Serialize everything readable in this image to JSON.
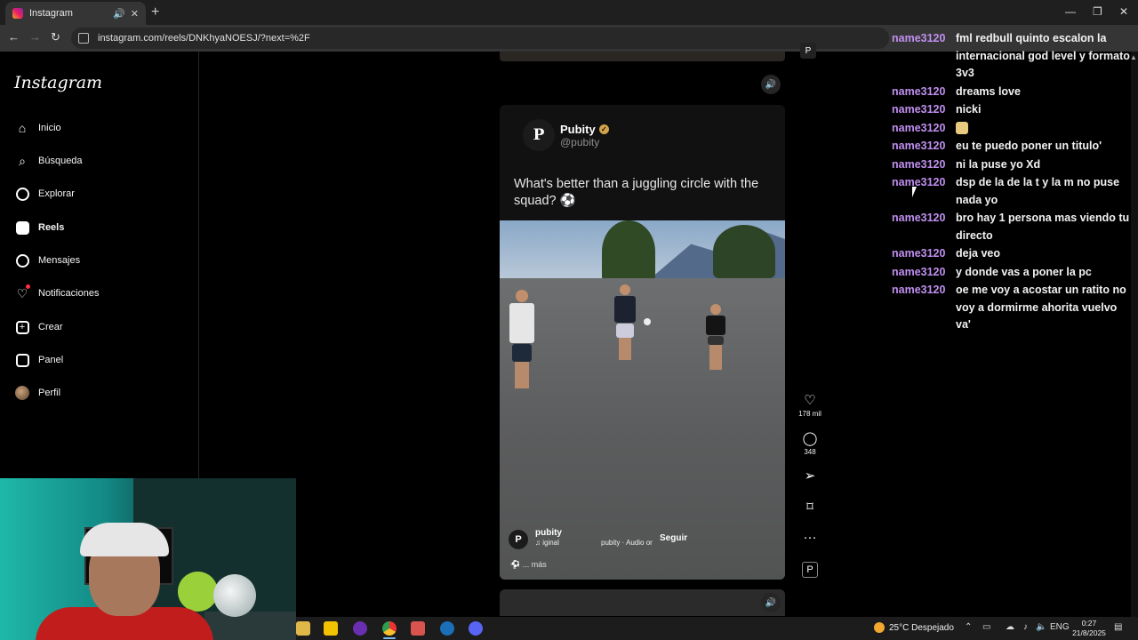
{
  "browser": {
    "tab_title": "Instagram",
    "url": "instagram.com/reels/DNKhyaNOESJ/?next=%2F",
    "new_tab": "+",
    "minimize": "—",
    "restore": "❐",
    "close": "✕",
    "back": "←",
    "forward": "→",
    "reload": "↻"
  },
  "sidebar": {
    "logo": "Instagram",
    "items": [
      {
        "label": "Inicio",
        "icon": "home-icon"
      },
      {
        "label": "Búsqueda",
        "icon": "search-icon"
      },
      {
        "label": "Explorar",
        "icon": "compass-icon"
      },
      {
        "label": "Reels",
        "icon": "reels-icon",
        "active": true
      },
      {
        "label": "Mensajes",
        "icon": "messenger-icon"
      },
      {
        "label": "Notificaciones",
        "icon": "heart-icon"
      },
      {
        "label": "Crear",
        "icon": "plus-square-icon"
      },
      {
        "label": "Panel",
        "icon": "chart-icon"
      },
      {
        "label": "Perfil",
        "icon": "avatar-icon"
      }
    ]
  },
  "post": {
    "name": "Pubity",
    "handle": "@pubity",
    "caption": "What's better than a juggling circle with the squad? ⚽",
    "reel_user": "pubity",
    "reel_audio_left": "♫ iginal",
    "reel_audio_right": "pubity · Audio or",
    "follow": "Seguir",
    "more": "... más"
  },
  "actions": {
    "likes": "178 mil",
    "comments": "348"
  },
  "chat": [
    {
      "user": "name3120",
      "msg": "fml redbull quinto escalon la internacional god level y formato 3v3"
    },
    {
      "user": "name3120",
      "msg": "dreams love"
    },
    {
      "user": "name3120",
      "msg": "nicki"
    },
    {
      "user": "name3120",
      "msg": "",
      "emote": true
    },
    {
      "user": "name3120",
      "msg": "eu te puedo poner un titulo'"
    },
    {
      "user": "name3120",
      "msg": "ni la puse yo Xd"
    },
    {
      "user": "name3120",
      "msg": "dsp de la de la t y la m no puse nada yo"
    },
    {
      "user": "name3120",
      "msg": "bro hay 1 persona mas viendo tu directo"
    },
    {
      "user": "name3120",
      "msg": "deja veo"
    },
    {
      "user": "name3120",
      "msg": "y donde vas a poner la pc"
    },
    {
      "user": "name3120",
      "msg": "oe me voy a acostar un ratito no voy a dormirme ahorita vuelvo va'"
    }
  ],
  "taskbar": {
    "weather": "25°C Despejado",
    "lang": "ENG",
    "time": "0:27",
    "date": "21/8/2025"
  },
  "colors": {
    "chat_user": "#c08ff0",
    "background": "#000000",
    "verified": "#d2a44a"
  }
}
